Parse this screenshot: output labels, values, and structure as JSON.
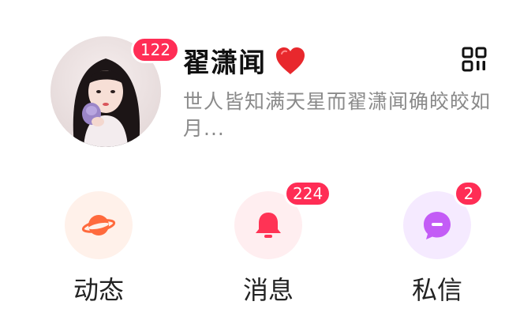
{
  "profile": {
    "name": "翟潇闻",
    "avatar_badge": "122",
    "bio": "世人皆知满天星而翟潇闻确皎皎如月..."
  },
  "icons": {
    "name_emoji": "heart-icon",
    "top_right": "qr-code-icon"
  },
  "actions": [
    {
      "label": "动态",
      "icon": "planet-icon",
      "badge": ""
    },
    {
      "label": "消息",
      "icon": "bell-icon",
      "badge": "224"
    },
    {
      "label": "私信",
      "icon": "chat-bubble-icon",
      "badge": "2"
    }
  ],
  "colors": {
    "badge": "#ff2d55",
    "heart": "#e8282d",
    "bio_text": "#8a8a8a",
    "dongtai_bg": "#fff1ea",
    "dongtai_icon": "#ff6a3d",
    "xiaoxi_bg": "#ffeef0",
    "xiaoxi_icon": "#ff3355",
    "sixin_bg": "#f5eaff",
    "sixin_icon": "#c35cf6"
  }
}
